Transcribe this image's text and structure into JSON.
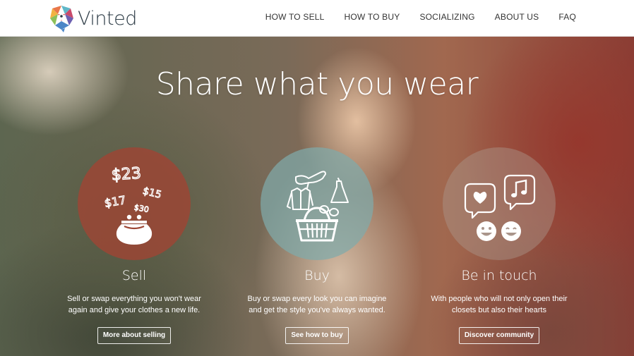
{
  "brand": {
    "name": "Vinted",
    "logo_icon": "vinted-logo-icon"
  },
  "nav": [
    {
      "label": "HOW TO SELL"
    },
    {
      "label": "HOW TO BUY"
    },
    {
      "label": "SOCIALIZING"
    },
    {
      "label": "ABOUT US"
    },
    {
      "label": "FAQ"
    }
  ],
  "hero": {
    "headline": "Share what you wear",
    "features": [
      {
        "title": "Sell",
        "description": "Sell or swap everything you won't wear\nagain and give your clothes a new life.",
        "button": "More about selling",
        "price_tags": [
          "$23",
          "$15",
          "$17",
          "$30"
        ],
        "icon": "coin-purse-icon",
        "circle_color": "#9e4634"
      },
      {
        "title": "Buy",
        "description": "Buy or swap every look you can imagine\nand get the style you've always wanted.",
        "button": "See how to buy",
        "icon": "shopping-basket-icon",
        "circle_color": "#80aaaa"
      },
      {
        "title": "Be in touch",
        "description": "With people who will not only open their\nclosets but also their hearts",
        "button": "Discover community",
        "icon": "chat-bubbles-icon",
        "circle_color": "#aa968c"
      }
    ]
  }
}
